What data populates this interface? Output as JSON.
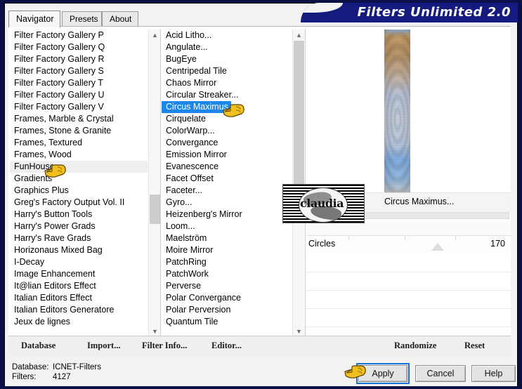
{
  "window": {
    "title": "Filters Unlimited 2.0",
    "title_color": "#151b7e"
  },
  "tabs": [
    {
      "label": "Navigator",
      "active": true
    },
    {
      "label": "Presets",
      "active": false
    },
    {
      "label": "About",
      "active": false
    }
  ],
  "categories": {
    "items": [
      "Filter Factory Gallery P",
      "Filter Factory Gallery Q",
      "Filter Factory Gallery R",
      "Filter Factory Gallery S",
      "Filter Factory Gallery T",
      "Filter Factory Gallery U",
      "Filter Factory Gallery V",
      "Frames, Marble & Crystal",
      "Frames, Stone & Granite",
      "Frames, Textured",
      "Frames, Wood",
      "FunHouse",
      "Gradients",
      "Graphics Plus",
      "Greg's Factory Output Vol. II",
      "Harry's Button Tools",
      "Harry's Power Grads",
      "Harry's Rave Grads",
      "Horizonaus Mixed Bag",
      "I-Decay",
      "Image Enhancement",
      "It@lian Editors Effect",
      "Italian Editors Effect",
      "Italian Editors Generatore",
      "Jeux de lignes"
    ],
    "hovered": "FunHouse",
    "scroll_up_icon": "chevron-up-icon",
    "scroll_down_icon": "chevron-down-icon"
  },
  "filters": {
    "items": [
      "Acid Litho...",
      "Angulate...",
      "BugEye",
      "Centripedal Tile",
      "Chaos Mirror",
      "Circular Streaker...",
      "Circus Maximus",
      "Cirquelate",
      "ColorWarp...",
      "Convergance",
      "Emission Mirror",
      "Evanescence",
      "Facet Offset",
      "Faceter...",
      "Gyro...",
      "Heizenberg's Mirror",
      "Loom...",
      "Maelström",
      "Moire Mirror",
      "PatchRing",
      "PatchWork",
      "Perverse",
      "Polar Convergance",
      "Polar Perversion",
      "Quantum Tile"
    ],
    "selected": "Circus Maximus",
    "selected_color": "#1c87e8"
  },
  "preview": {
    "filter_name": "Circus Maximus...",
    "watermark_text": "claudia"
  },
  "parameters": [
    {
      "label": "Circles",
      "value": "170"
    }
  ],
  "toolbar": {
    "database": "Database",
    "import": "Import...",
    "filter_info": "Filter Info...",
    "editor": "Editor...",
    "randomize": "Randomize",
    "reset": "Reset"
  },
  "status": {
    "database_label": "Database:",
    "database_value": "ICNET-Filters",
    "filters_label": "Filters:",
    "filters_value": "4127"
  },
  "actions": {
    "apply": "Apply",
    "cancel": "Cancel",
    "help": "Help"
  }
}
